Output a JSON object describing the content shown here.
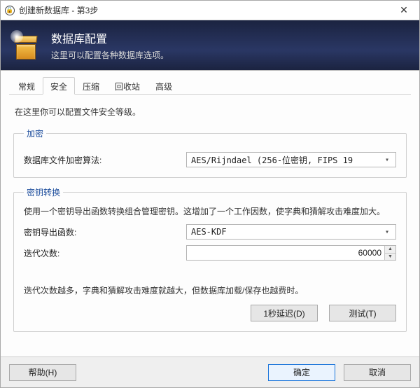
{
  "window": {
    "title": "创建新数据库  -  第3步"
  },
  "banner": {
    "title": "数据库配置",
    "subtitle": "这里可以配置各种数据库选项。"
  },
  "tabs": {
    "items": [
      {
        "label": "常规"
      },
      {
        "label": "安全"
      },
      {
        "label": "压缩"
      },
      {
        "label": "回收站"
      },
      {
        "label": "高级"
      }
    ],
    "active_index": 1
  },
  "security": {
    "desc": "在这里你可以配置文件安全等级。",
    "encryption": {
      "legend": "加密",
      "algo_label": "数据库文件加密算法:",
      "algo_value": "AES/Rijndael (256-位密钥, FIPS 19"
    },
    "kdf": {
      "legend": "密钥转换",
      "desc": "使用一个密钥导出函数转换组合管理密钥。这增加了一个工作因数，使字典和猜解攻击难度加大。",
      "func_label": "密钥导出函数:",
      "func_value": "AES-KDF",
      "iter_label": "迭代次数:",
      "iter_value": "60000",
      "hint": "迭代次数越多，字典和猜解攻击难度就越大，但数据库加载/保存也越费时。",
      "delay_btn": "1秒延迟(D)",
      "test_btn": "测试(T)"
    }
  },
  "footer": {
    "help": "帮助(H)",
    "ok": "确定",
    "cancel": "取消"
  }
}
